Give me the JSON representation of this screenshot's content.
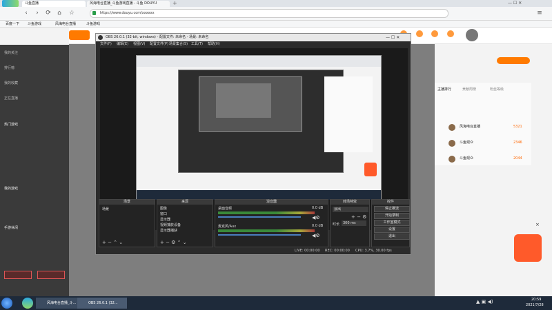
{
  "browser": {
    "tabs": [
      "斗鱼直播",
      "风海电台直播_斗鱼游戏直播 - 斗鱼 DOUYU"
    ],
    "address": "https://www.douyu.com/xxxxxx",
    "bookmarks": [
      "百度一下",
      "斗鱼游戏",
      "风海电台直播",
      "斗鱼游戏"
    ]
  },
  "sidebar": {
    "items": [
      "我的关注",
      "排行榜",
      "我的收藏",
      "正在直播"
    ],
    "sections": [
      "热门游戏",
      "我的游戏",
      "手游休闲"
    ]
  },
  "obs": {
    "title": "OBS 26.0.1 (32-bit, windows) - 配置文件: 未命名 - 场景: 未命名",
    "menu": [
      "文件(F)",
      "编辑(E)",
      "视图(V)",
      "配置文件(P)",
      "场景集合(S)",
      "工具(T)",
      "帮助(H)"
    ],
    "docks": {
      "scenes": {
        "title": "场景",
        "items": [
          "场景"
        ]
      },
      "sources": {
        "title": "来源",
        "items": [
          "图像",
          "窗口",
          "显示器",
          "视频捕获设备",
          "显示器捕获"
        ]
      },
      "mixer": {
        "title": "混音器",
        "tracks": [
          "桌面音频",
          "麦克风/Aux"
        ],
        "level": "0.0 dB"
      },
      "transitions": {
        "title": "转场特效",
        "type": "淡出",
        "duration_label": "时长",
        "duration": "300 ms"
      },
      "controls": {
        "title": "控件",
        "buttons": [
          "停止推流",
          "开始录制",
          "工作室模式",
          "设置",
          "退出"
        ]
      }
    },
    "status": {
      "live": "LIVE: 00:00:00",
      "rec": "REC: 00:00:00",
      "cpu": "CPU: 3.7%, 30.00 fps"
    }
  },
  "leaderboard": {
    "tabs": [
      "主播排行",
      "贡献周榜",
      "粉丝等级"
    ],
    "rows": [
      {
        "name": "风海电台直播",
        "score": "5321"
      },
      {
        "name": "斗鱼观众",
        "score": "2346"
      },
      {
        "name": "斗鱼观众",
        "score": "2044"
      }
    ]
  },
  "taskbar": {
    "items": [
      "风海电台直播_斗...",
      "OBS 26.0.1 (32..."
    ],
    "time": "20:59",
    "date": "2021/7/28"
  }
}
